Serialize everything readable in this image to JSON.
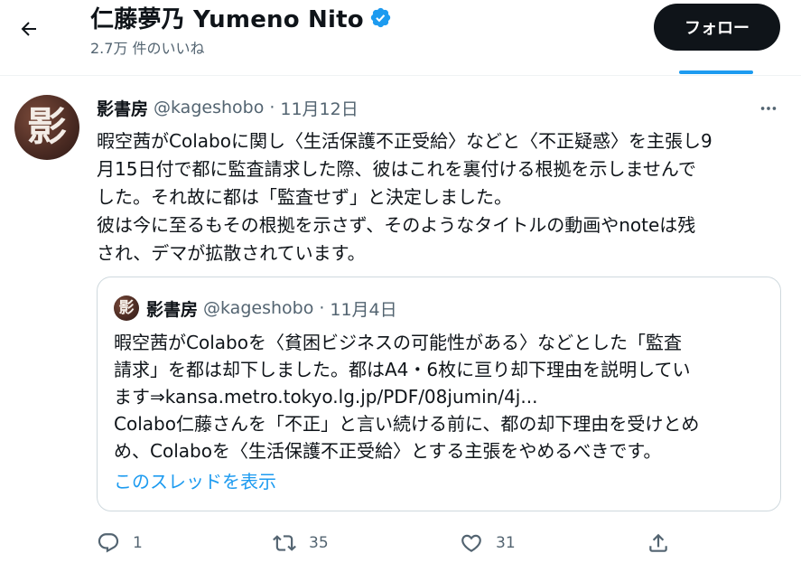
{
  "header": {
    "name": "仁藤夢乃 Yumeno Nito",
    "likes_count": "2.7万 件のいいね",
    "follow_label": "フォロー",
    "icons": {
      "back": "arrow-left-icon",
      "verified": "verified-badge-icon"
    }
  },
  "tweet": {
    "avatar_text": "影",
    "author_name": "影書房",
    "author_handle": "@kageshobo",
    "dot": "·",
    "date": "11月12日",
    "lines": [
      "暇空茜がColaboに関し〈生活保護不正受給〉などと〈不正疑惑〉を主張し9",
      "月15日付で都に監査請求した際、彼はこれを裏付ける根拠を示しませんで",
      "した。それ故に都は「監査せず」と決定しました。",
      "彼は今に至るもその根拠を示さず、そのようなタイトルの動画やnoteは残",
      "され、デマが拡散されています。"
    ]
  },
  "quote": {
    "avatar_text": "影",
    "author_name": "影書房",
    "author_handle": "@kageshobo",
    "dot": "·",
    "date": "11月4日",
    "lines": [
      "暇空茜がColaboを〈貧困ビジネスの可能性がある〉などとした「監査",
      "請求」を都は却下しました。都はA4・6枚に亘り却下理由を説明してい",
      "ます⇒kansa.metro.tokyo.lg.jp/PDF/08jumin/4j...",
      "Colabo仁藤さんを「不正」と言い続ける前に、都の却下理由を受けとめ",
      "め、Colaboを〈生活保護不正受給〉とする主張をやめるべきです。"
    ],
    "show_thread": "このスレッドを表示"
  },
  "actions": {
    "reply_count": "1",
    "retweet_count": "35",
    "like_count": "31",
    "icons": [
      "reply-icon",
      "retweet-icon",
      "like-icon",
      "share-icon"
    ]
  },
  "colors": {
    "accent": "#1d9bf0",
    "text": "#0f1419",
    "secondary": "#536471",
    "border": "#cfd9de",
    "follow_bg": "#0f1419"
  }
}
